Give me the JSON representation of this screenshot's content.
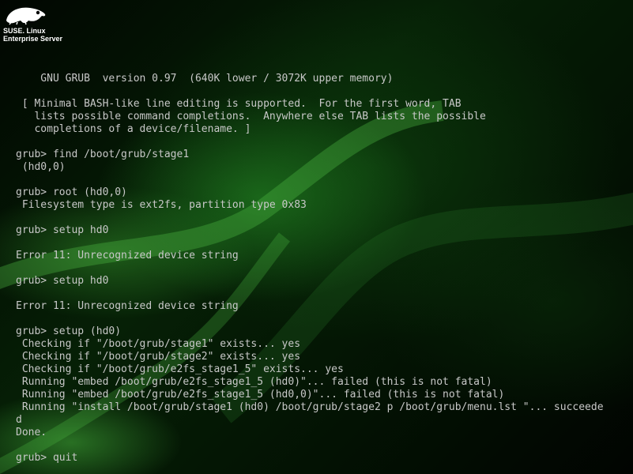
{
  "brand": {
    "line1": "SUSE. Linux",
    "line2": "Enterprise Server"
  },
  "terminal": {
    "lines": [
      "",
      "    GNU GRUB  version 0.97  (640K lower / 3072K upper memory)",
      "",
      " [ Minimal BASH-like line editing is supported.  For the first word, TAB",
      "   lists possible command completions.  Anywhere else TAB lists the possible",
      "   completions of a device/filename. ]",
      "",
      "grub> find /boot/grub/stage1",
      " (hd0,0)",
      "",
      "grub> root (hd0,0)",
      " Filesystem type is ext2fs, partition type 0x83",
      "",
      "grub> setup hd0",
      "",
      "Error 11: Unrecognized device string",
      "",
      "grub> setup hd0",
      "",
      "Error 11: Unrecognized device string",
      "",
      "grub> setup (hd0)",
      " Checking if \"/boot/grub/stage1\" exists... yes",
      " Checking if \"/boot/grub/stage2\" exists... yes",
      " Checking if \"/boot/grub/e2fs_stage1_5\" exists... yes",
      " Running \"embed /boot/grub/e2fs_stage1_5 (hd0)\"... failed (this is not fatal)",
      " Running \"embed /boot/grub/e2fs_stage1_5 (hd0,0)\"... failed (this is not fatal)",
      " Running \"install /boot/grub/stage1 (hd0) /boot/grub/stage2 p /boot/grub/menu.lst \"... succeede",
      "d",
      "Done.",
      "",
      "grub> quit"
    ]
  },
  "colors": {
    "text": "#c8c8c8",
    "background": "#000000",
    "glow": "#2e9a2e"
  },
  "icons": {
    "logo": "suse-chameleon-icon"
  }
}
